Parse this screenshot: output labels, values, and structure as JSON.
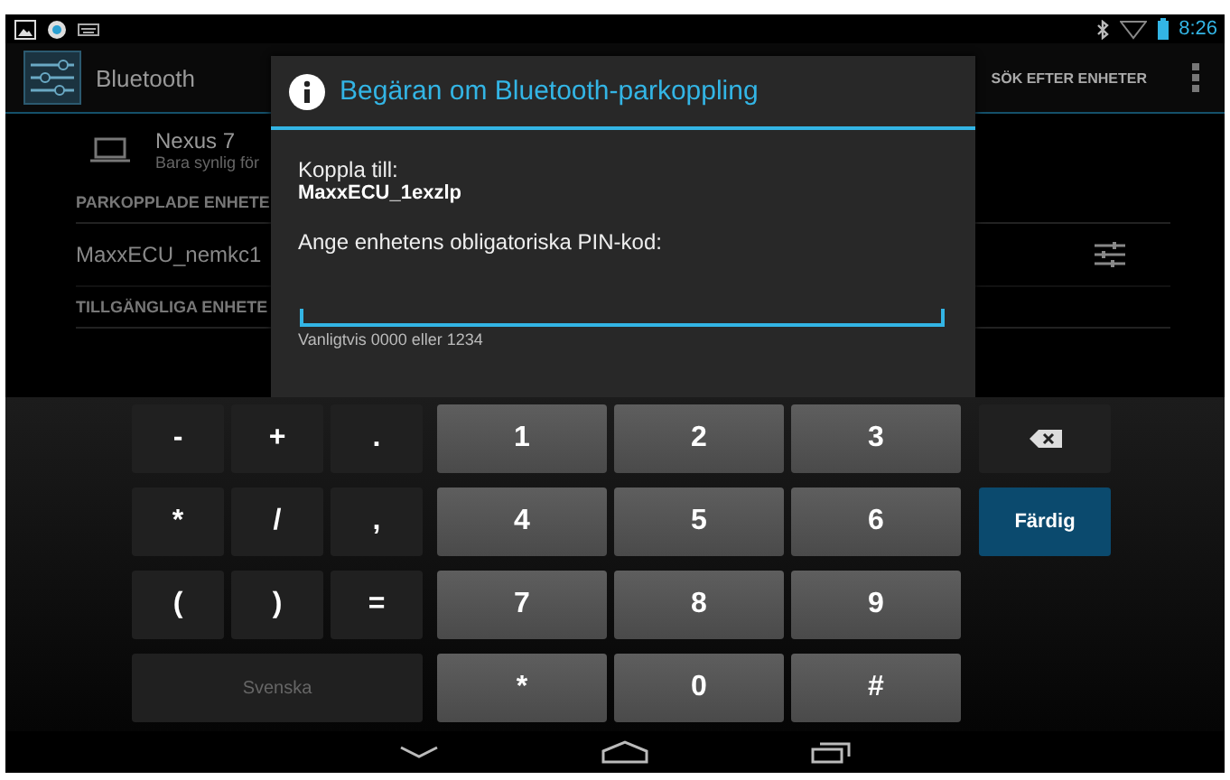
{
  "status_bar": {
    "time": "8:26"
  },
  "action_bar": {
    "title": "Bluetooth",
    "action": "SÖK EFTER ENHETER"
  },
  "this_device": {
    "name": "Nexus 7",
    "subtitle": "Bara synlig för"
  },
  "list": [
    {
      "kind": "header",
      "text": "PARKOPPLADE ENHETE"
    },
    {
      "kind": "device",
      "text": "MaxxECU_nemkc1"
    },
    {
      "kind": "header",
      "text": "TILLGÄNGLIGA ENHETE"
    }
  ],
  "dialog": {
    "title": "Begäran om Bluetooth-parkoppling",
    "label": "Koppla till:",
    "device": "MaxxECU_1exzlp",
    "prompt": "Ange enhetens obligatoriska PIN-kod:",
    "hint": "Vanligtvis 0000 eller 1234"
  },
  "keyboard": {
    "symbol_rows": [
      [
        "-",
        "+",
        "."
      ],
      [
        "*",
        "/",
        ","
      ],
      [
        "(",
        ")",
        "="
      ]
    ],
    "language_key": "Svenska",
    "digit_rows": [
      [
        "1",
        "2",
        "3"
      ],
      [
        "4",
        "5",
        "6"
      ],
      [
        "7",
        "8",
        "9"
      ],
      [
        "*",
        "0",
        "#"
      ]
    ],
    "action_key": "Färdig"
  }
}
